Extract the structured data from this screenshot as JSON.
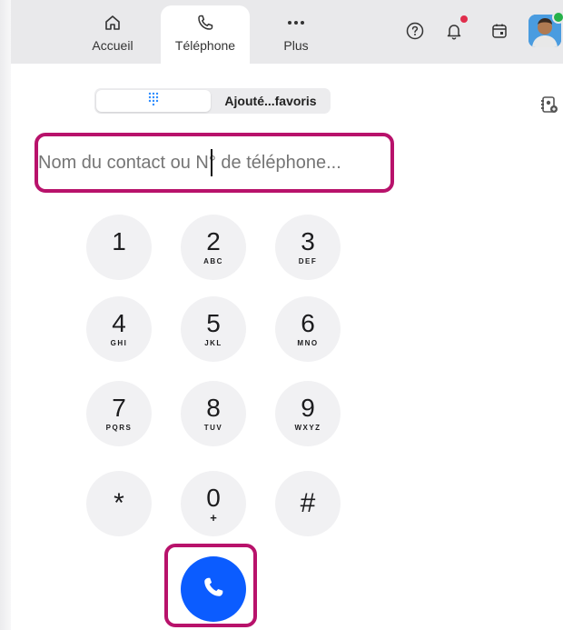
{
  "nav": {
    "tabs": [
      {
        "label": "Accueil",
        "icon": "home-icon"
      },
      {
        "label": "Téléphone",
        "icon": "phone-icon",
        "active": true
      },
      {
        "label": "Plus",
        "icon": "more-icon"
      }
    ]
  },
  "topbar": {
    "icons": [
      "help-icon",
      "notifications-icon",
      "calendar-icon",
      "avatar"
    ],
    "notification_badge_color": "#e02e4c",
    "presence_color": "#26b14a"
  },
  "segmented": {
    "options": [
      {
        "label": "",
        "icon": "dialpad-icon",
        "selected": true
      },
      {
        "label": "Ajouté...favoris",
        "selected": false
      }
    ]
  },
  "search": {
    "placeholder": "Nom du contact ou N° de téléphone...",
    "value": ""
  },
  "keypad": {
    "keys": [
      {
        "digit": "1",
        "letters": ""
      },
      {
        "digit": "2",
        "letters": "ABC"
      },
      {
        "digit": "3",
        "letters": "DEF"
      },
      {
        "digit": "4",
        "letters": "GHI"
      },
      {
        "digit": "5",
        "letters": "JKL"
      },
      {
        "digit": "6",
        "letters": "MNO"
      },
      {
        "digit": "7",
        "letters": "PQRS"
      },
      {
        "digit": "8",
        "letters": "TUV"
      },
      {
        "digit": "9",
        "letters": "WXYZ"
      },
      {
        "digit": "*",
        "letters": ""
      },
      {
        "digit": "0",
        "letters": "+"
      },
      {
        "digit": "#",
        "letters": ""
      }
    ]
  },
  "call": {
    "icon": "phone-call-icon",
    "color": "#0b5cff"
  },
  "highlight_color": "#b8126b"
}
